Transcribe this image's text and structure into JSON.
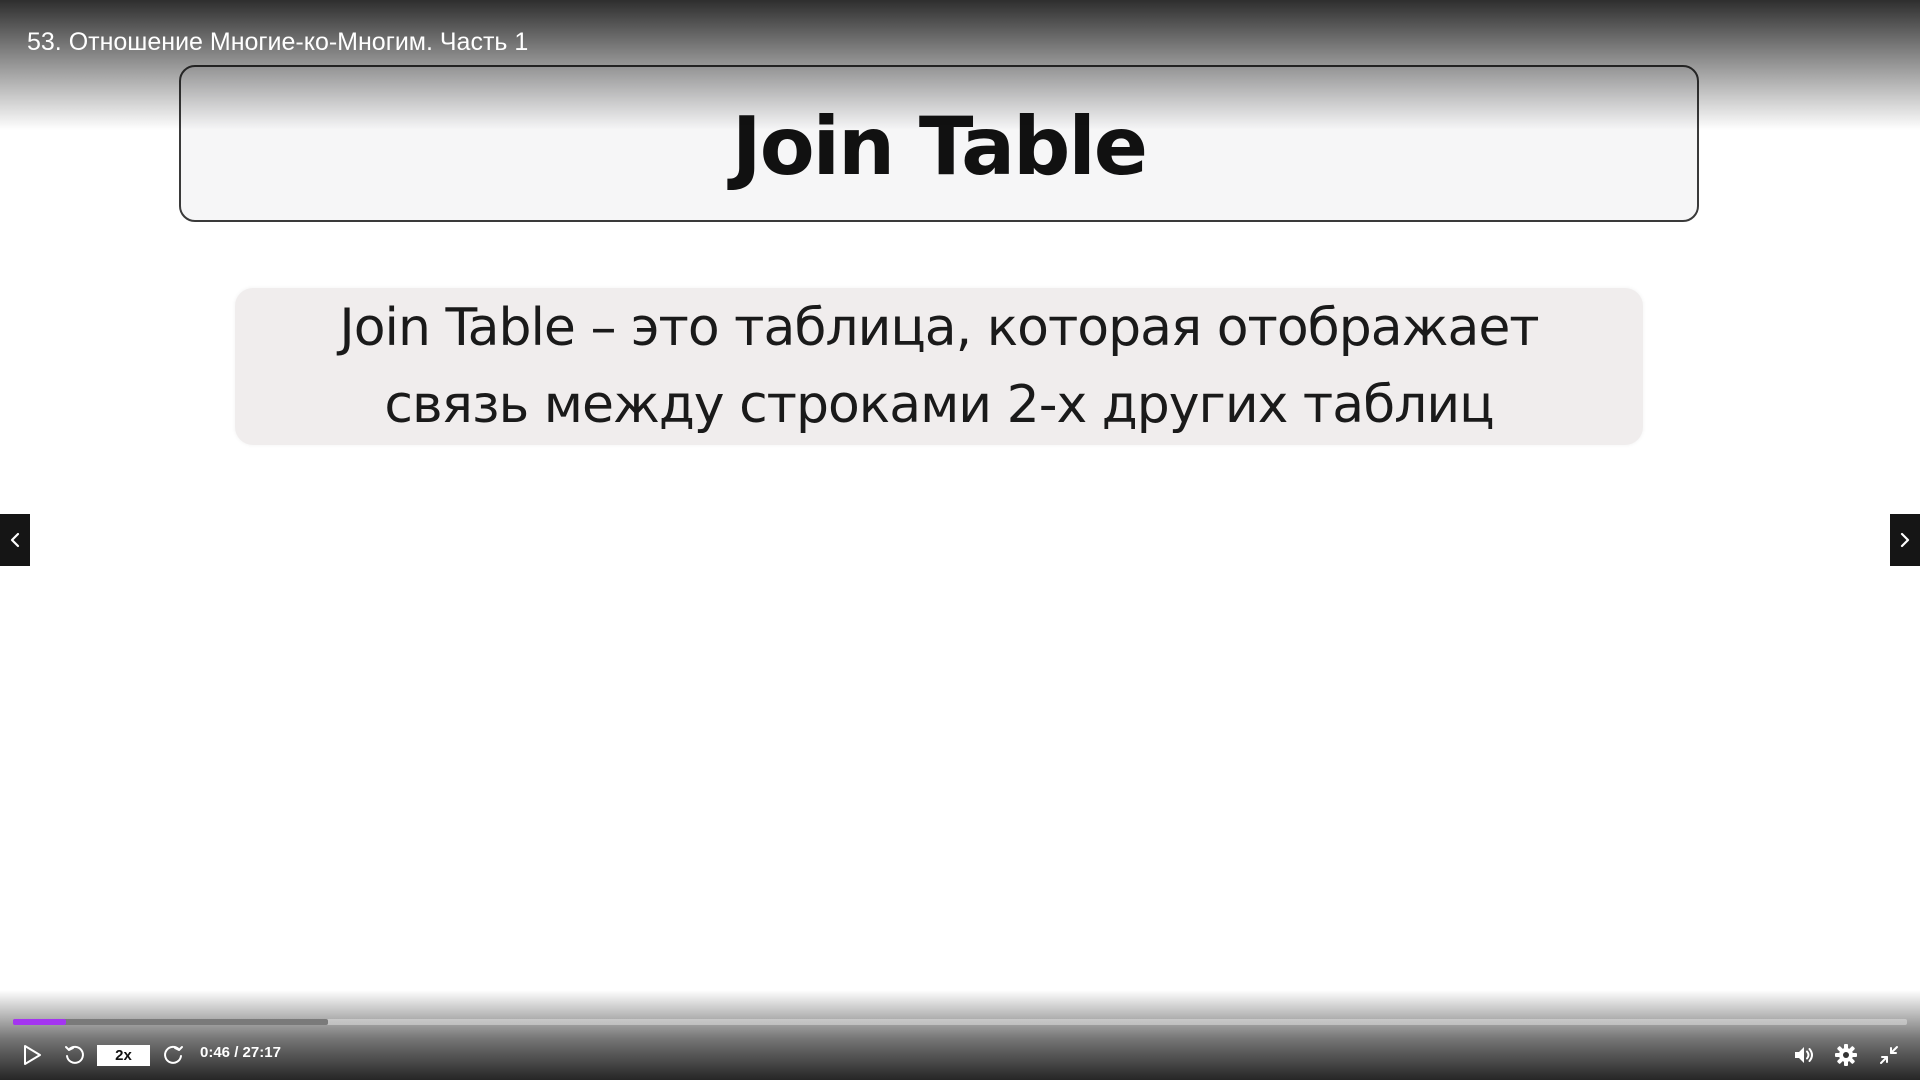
{
  "player": {
    "title": "53. Отношение Многие-ко-Многим. Часть 1",
    "speed_label": "2x",
    "time_current": "0:46",
    "time_separator": " / ",
    "time_total": "27:17",
    "progress_played_fraction": 0.0281,
    "progress_buffered_fraction": 0.1665,
    "accent_color": "#a435f0"
  },
  "slide": {
    "title": "Join Table",
    "definition_lines": [
      "Join Table – это таблица, которая отображает",
      "связь между строками 2-х других таблиц"
    ]
  },
  "icons": {
    "play": "play-icon",
    "rewind": "rewind-icon",
    "forward": "forward-icon",
    "volume": "volume-icon",
    "settings": "gear-icon",
    "exit_fullscreen": "exit-fullscreen-icon",
    "prev": "chevron-left-icon",
    "next": "chevron-right-icon"
  }
}
